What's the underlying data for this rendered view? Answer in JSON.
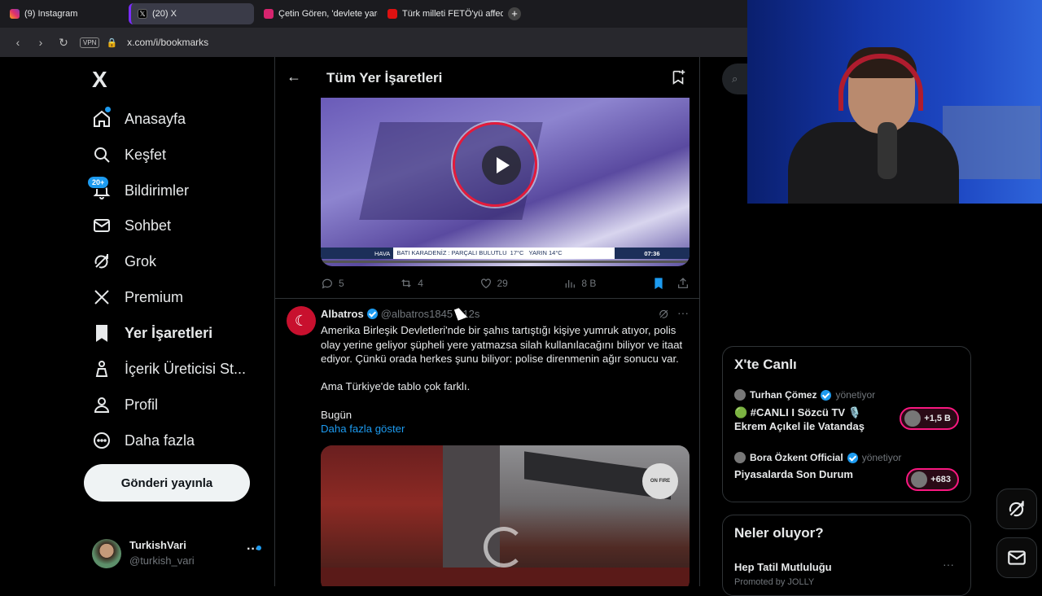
{
  "browser": {
    "tabs": [
      {
        "label": "(9) Instagram"
      },
      {
        "label": "(20) X"
      },
      {
        "label": "Çetin Gören, 'devlete yard"
      },
      {
        "label": "Türk milleti FETÖ'yü affede"
      }
    ],
    "vpn_label": "VPN",
    "url": "x.com/i/bookmarks"
  },
  "nav": {
    "logo": "X",
    "notifications_badge": "20+",
    "items": [
      {
        "label": "Anasayfa",
        "icon": "home-icon"
      },
      {
        "label": "Keşfet",
        "icon": "search-icon"
      },
      {
        "label": "Bildirimler",
        "icon": "bell-icon"
      },
      {
        "label": "Sohbet",
        "icon": "mail-icon"
      },
      {
        "label": "Grok",
        "icon": "grok-icon"
      },
      {
        "label": "Premium",
        "icon": "x-logo-icon"
      },
      {
        "label": "Yer İşaretleri",
        "icon": "bookmark-icon"
      },
      {
        "label": "İçerik Üreticisi St...",
        "icon": "creator-icon"
      },
      {
        "label": "Profil",
        "icon": "person-icon"
      },
      {
        "label": "Daha fazla",
        "icon": "more-circle-icon"
      }
    ],
    "post_button": "Gönderi yayınla",
    "account": {
      "name": "TurkishVari",
      "handle": "@turkish_vari",
      "menu": "···"
    }
  },
  "timeline": {
    "title": "Tüm Yer İşaretleri",
    "tweet1": {
      "video_ticker": {
        "left": "HAVA",
        "text": "BATI KARADENİZ : PARÇALI BULUTLU  17°C   YARIN 14°C",
        "time": "07:36"
      },
      "stats": {
        "replies": "5",
        "retweets": "4",
        "likes": "29",
        "views": "8 B"
      }
    },
    "tweet2": {
      "name": "Albatros",
      "handle": "@albatros1845",
      "time": "12s",
      "menu": "···",
      "text1": "Amerika Birleşik Devletleri'nde bir şahıs tartıştığı kişiye yumruk atıyor, polis olay yerine geliyor şüpheli yere yatmazsa silah kullanılacağını biliyor ve itaat ediyor. Çünkü orada herkes şunu biliyor: polise direnmenin ağır sonucu var.",
      "text2": "Ama Türkiye'de tablo çok farklı.",
      "text3": "Bugün",
      "show_more": "Daha fazla göster",
      "sign": "ON FIRE"
    }
  },
  "right": {
    "live": {
      "title": "X'te Canlı",
      "items": [
        {
          "host": "Turhan Çömez",
          "role": "yönetiyor",
          "title": "🟢 #CANLI I Sözcü TV 🎙️ Ekrem Açıkel ile Vatandaş",
          "count": "+1,5 B"
        },
        {
          "host": "Bora Özkent Official",
          "role": "yönetiyor",
          "title": "Piyasalarda Son Durum",
          "count": "+683"
        }
      ]
    },
    "trends": {
      "title": "Neler oluyor?",
      "item": "Hep Tatil Mutluluğu",
      "promoted": "Promoted by JOLLY",
      "menu": "···"
    }
  },
  "colors": {
    "accent": "#1d9bf0",
    "live_pink": "#f91880",
    "bookmark_blue": "#1d9bf0"
  }
}
